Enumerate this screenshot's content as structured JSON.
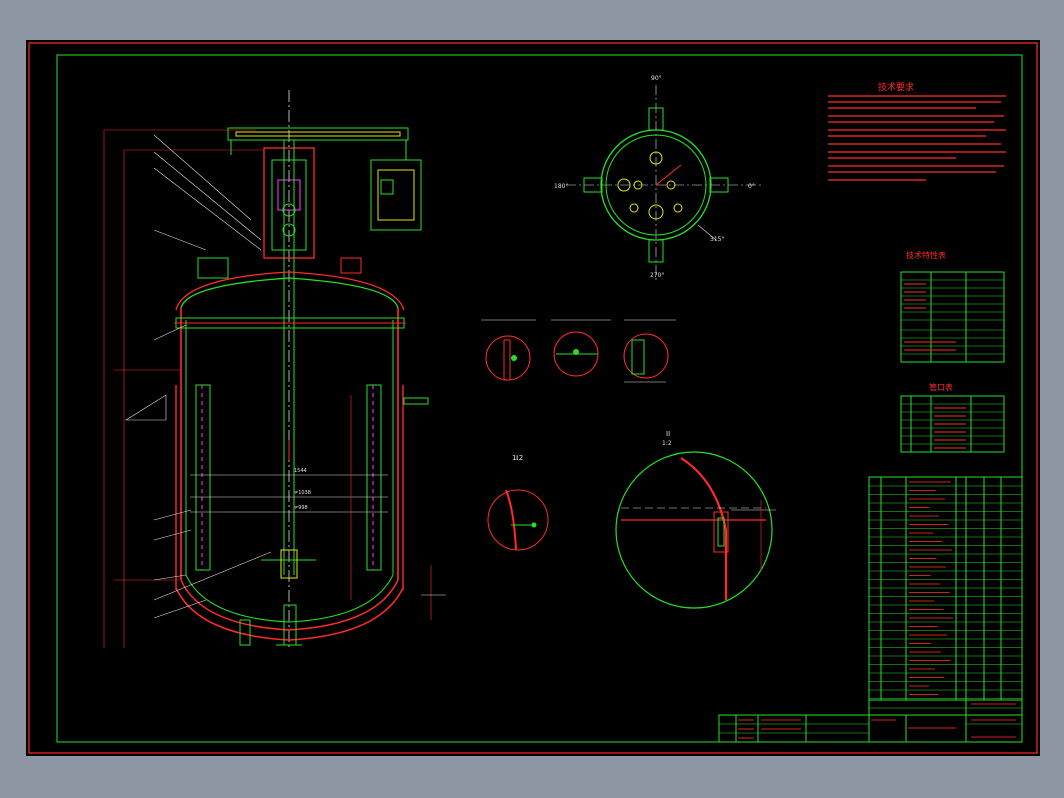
{
  "drawing": {
    "tech_requirements_title": "技术要求",
    "tech_spec_title": "技术特性表",
    "nozzle_table_title": "管口表",
    "view_angles": [
      "90°",
      "180°",
      "0°",
      "270°",
      "315°"
    ],
    "section_labels": [
      "I",
      "1:2",
      "II",
      "1:2"
    ],
    "dimensions": [
      "1544",
      "≠1038",
      "≠998"
    ]
  },
  "colors": {
    "background": "#000000",
    "frame": "#ff2a2a",
    "lines": "#27e027",
    "hatch": "#ff2a2a",
    "text_yellow": "#e6e600",
    "centerline": "#e0e0e0"
  }
}
